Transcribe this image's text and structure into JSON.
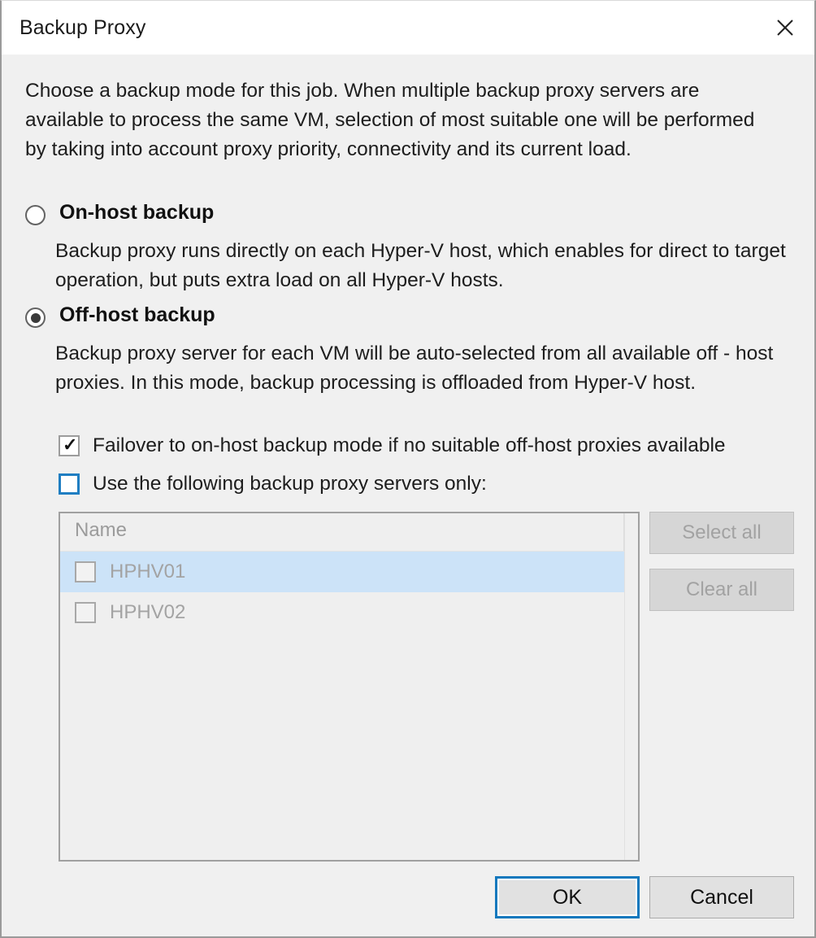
{
  "window": {
    "title": "Backup Proxy",
    "close_icon": "close-icon"
  },
  "main": {
    "intro": "Choose a backup mode for this job. When multiple backup proxy servers are available to process the same VM, selection of most suitable one will be performed by taking into account proxy priority, connectivity and its current load.",
    "modes": [
      {
        "id": "on-host",
        "label": "On-host backup",
        "selected": false,
        "description": "Backup proxy runs directly on each Hyper-V host, which enables for direct to target operation, but puts extra load on all Hyper-V hosts."
      },
      {
        "id": "off-host",
        "label": "Off-host backup",
        "selected": true,
        "description": "Backup proxy server for each VM will be auto-selected from all available off - host proxies. In this mode, backup processing is offloaded from Hyper-V host."
      }
    ],
    "options": [
      {
        "id": "failover",
        "label": "Failover to on-host backup mode if no suitable off-host proxies available",
        "checked": true,
        "focused": false
      },
      {
        "id": "use-following-proxies",
        "label": "Use the following backup proxy servers only:",
        "checked": false,
        "focused": true
      }
    ],
    "proxy_list": {
      "column_header": "Name",
      "enabled": false,
      "rows": [
        {
          "name": "HPHV01",
          "checked": false,
          "selected": true
        },
        {
          "name": "HPHV02",
          "checked": false,
          "selected": false
        }
      ]
    },
    "side_buttons": {
      "select_all": "Select all",
      "clear_all": "Clear all"
    }
  },
  "footer": {
    "ok": "OK",
    "cancel": "Cancel"
  },
  "colors": {
    "accent": "#1278bd",
    "selection": "#cce3f8",
    "dialog_bg": "#f0f0f0",
    "titlebar_bg": "#ffffff",
    "disabled_text": "#a2a2a2"
  }
}
